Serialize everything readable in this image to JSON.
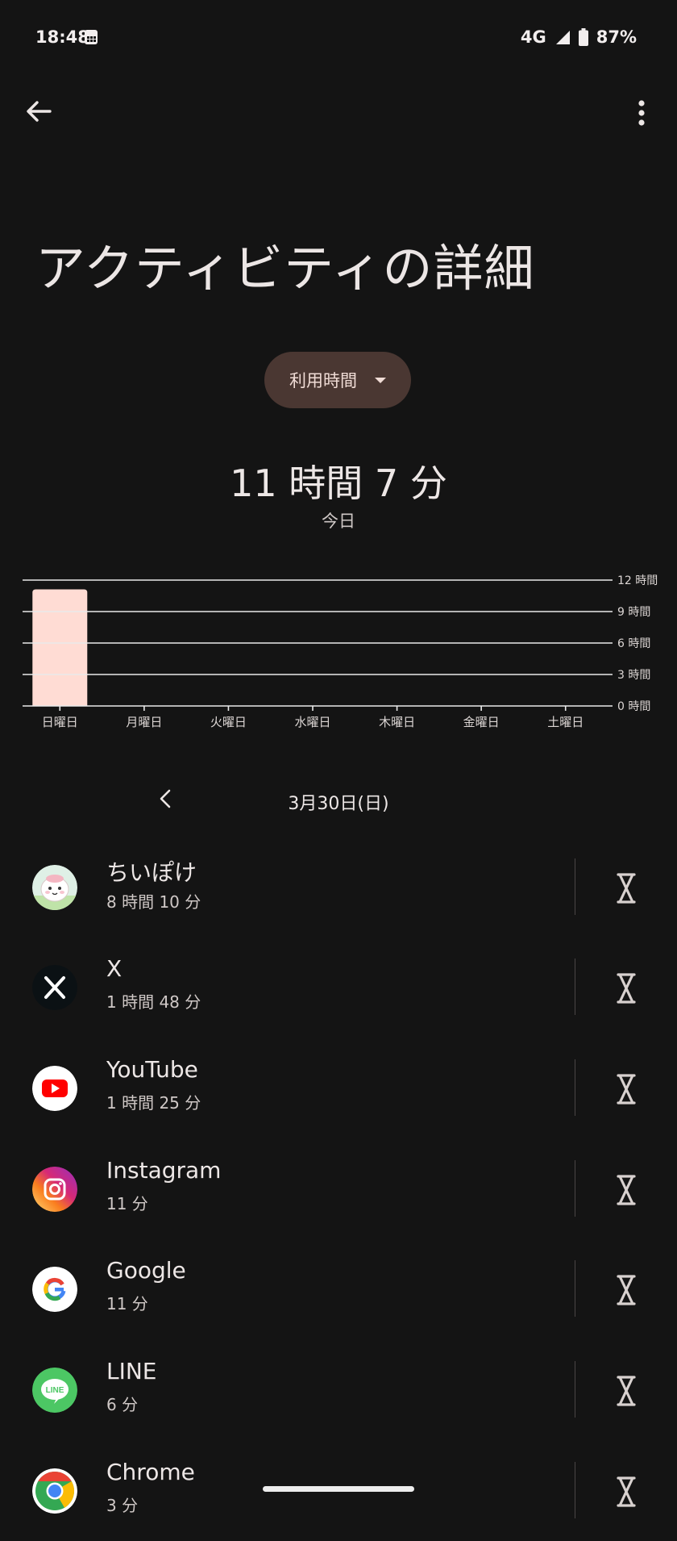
{
  "status_bar": {
    "time": "18:48",
    "network": "4G",
    "battery": "87%"
  },
  "header": {
    "title": "アクティビティの詳細"
  },
  "filter": {
    "label": "利用時間"
  },
  "summary": {
    "total": "11 時間 7 分",
    "period": "今日"
  },
  "chart_data": {
    "type": "bar",
    "categories": [
      "日曜日",
      "月曜日",
      "火曜日",
      "水曜日",
      "木曜日",
      "金曜日",
      "土曜日"
    ],
    "values": [
      11.12,
      0,
      0,
      0,
      0,
      0,
      0
    ],
    "ylim": [
      0,
      12
    ],
    "y_ticks": [
      {
        "value": 0,
        "label": "0 時間"
      },
      {
        "value": 3,
        "label": "3 時間"
      },
      {
        "value": 6,
        "label": "6 時間"
      },
      {
        "value": 9,
        "label": "9 時間"
      },
      {
        "value": 12,
        "label": "12 時間"
      }
    ],
    "bar_color": "#ffdcd4",
    "grid": true
  },
  "date_nav": {
    "label": "3月30日(日)"
  },
  "apps": [
    {
      "name": "ちいぽけ",
      "time": "8 時間 10 分",
      "icon": "chiipoke-icon"
    },
    {
      "name": "X",
      "time": "1 時間 48 分",
      "icon": "x-icon"
    },
    {
      "name": "YouTube",
      "time": "1 時間 25 分",
      "icon": "youtube-icon"
    },
    {
      "name": "Instagram",
      "time": "11 分",
      "icon": "instagram-icon"
    },
    {
      "name": "Google",
      "time": "11 分",
      "icon": "google-icon"
    },
    {
      "name": "LINE",
      "time": "6 分",
      "icon": "line-icon"
    },
    {
      "name": "Chrome",
      "time": "3 分",
      "icon": "chrome-icon"
    }
  ]
}
